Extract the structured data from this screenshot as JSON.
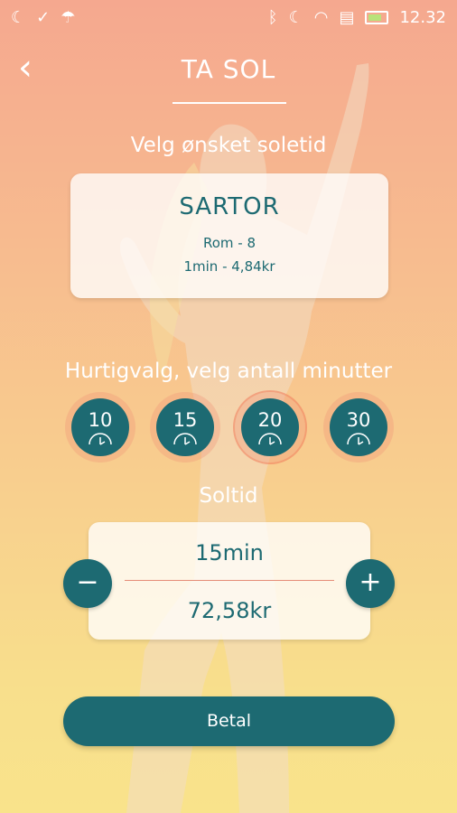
{
  "status_bar": {
    "time": "12.32",
    "icons_left": [
      "moon-icon",
      "check-icon",
      "android-icon"
    ],
    "icons_right": [
      "bluetooth-icon",
      "moon-icon",
      "wifi-icon",
      "sim-icon",
      "battery-icon"
    ]
  },
  "header": {
    "back_icon": "chevron-left-icon",
    "back_glyph": "‹",
    "title": "TA SOL"
  },
  "selected_time_label": "Velg ønsket soletid",
  "salon": {
    "name": "SARTOR",
    "room": "Rom - 8",
    "price_rate": "1min - 4,84kr"
  },
  "quick_select": {
    "label": "Hurtigvalg, velg antall minutter",
    "options": [
      "10",
      "15",
      "20",
      "30"
    ],
    "active_index": 2
  },
  "solar_time": {
    "label": "Soltid",
    "minutes": "15min",
    "price": "72,58kr",
    "minus_glyph": "−",
    "plus_glyph": "+"
  },
  "pay_button": {
    "label": "Betal"
  },
  "colors": {
    "primary": "#1d6a72",
    "gradient_top": "#f5a88f",
    "gradient_bottom": "#f9e38b",
    "accent": "#e58c77"
  }
}
